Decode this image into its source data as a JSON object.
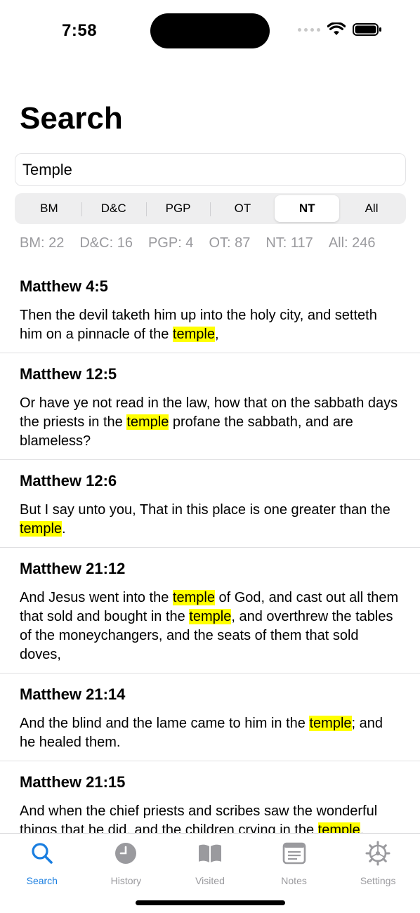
{
  "status_bar": {
    "time": "7:58"
  },
  "page": {
    "title": "Search"
  },
  "search": {
    "value": "Temple",
    "placeholder": ""
  },
  "segments": [
    {
      "label": "BM",
      "selected": false
    },
    {
      "label": "D&C",
      "selected": false
    },
    {
      "label": "PGP",
      "selected": false
    },
    {
      "label": "OT",
      "selected": false
    },
    {
      "label": "NT",
      "selected": true
    },
    {
      "label": "All",
      "selected": false
    }
  ],
  "counts": [
    "BM: 22",
    "D&C: 16",
    "PGP: 4",
    "OT: 87",
    "NT: 117",
    "All: 246"
  ],
  "highlight_color": "#ffff00",
  "accent_color": "#1a7ee0",
  "results": [
    {
      "reference": "Matthew 4:5",
      "parts": [
        {
          "text": "Then the devil taketh him up into the holy city, and setteth him on a pinnacle of the "
        },
        {
          "text": "temple",
          "hl": true
        },
        {
          "text": ","
        }
      ]
    },
    {
      "reference": "Matthew 12:5",
      "parts": [
        {
          "text": "Or have ye not read in the law, how that on the sabbath days the priests in the "
        },
        {
          "text": "temple",
          "hl": true
        },
        {
          "text": " profane the sabbath, and are blameless?"
        }
      ]
    },
    {
      "reference": "Matthew 12:6",
      "parts": [
        {
          "text": "But I say unto you, That in this place is one greater than the "
        },
        {
          "text": "temple",
          "hl": true
        },
        {
          "text": "."
        }
      ]
    },
    {
      "reference": "Matthew 21:12",
      "parts": [
        {
          "text": "And Jesus went into the "
        },
        {
          "text": "temple",
          "hl": true
        },
        {
          "text": " of God, and cast out all them that sold and bought in the "
        },
        {
          "text": "temple",
          "hl": true
        },
        {
          "text": ", and overthrew the tables of the moneychangers, and the seats of them that sold doves,"
        }
      ]
    },
    {
      "reference": "Matthew 21:14",
      "parts": [
        {
          "text": "And the blind and the lame came to him in the "
        },
        {
          "text": "temple",
          "hl": true
        },
        {
          "text": "; and he healed them."
        }
      ]
    },
    {
      "reference": "Matthew 21:15",
      "parts": [
        {
          "text": "And when the chief priests and scribes saw the wonderful things that he did, and the children crying in the "
        },
        {
          "text": "temple",
          "hl": true
        },
        {
          "text": ","
        }
      ]
    }
  ],
  "tabs": [
    {
      "label": "Search",
      "icon": "search-icon",
      "active": true
    },
    {
      "label": "History",
      "icon": "clock-icon",
      "active": false
    },
    {
      "label": "Visited",
      "icon": "book-icon",
      "active": false
    },
    {
      "label": "Notes",
      "icon": "notes-icon",
      "active": false
    },
    {
      "label": "Settings",
      "icon": "gear-icon",
      "active": false
    }
  ]
}
